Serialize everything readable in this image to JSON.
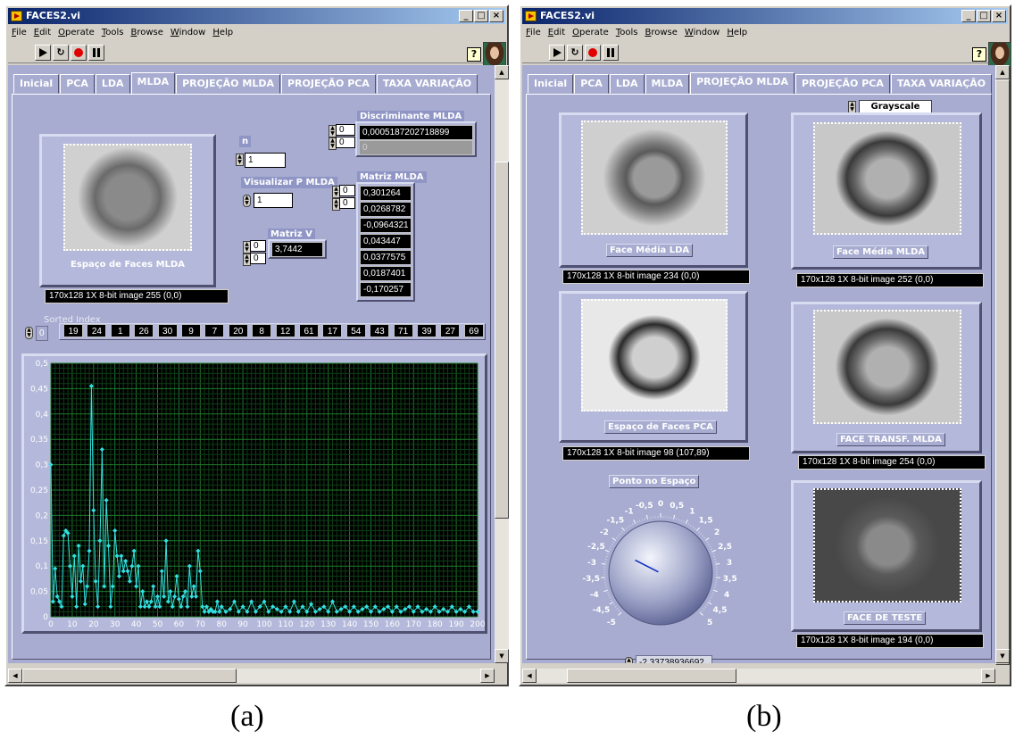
{
  "window_a": {
    "title": "FACES2.vi",
    "menu": [
      "File",
      "Edit",
      "Operate",
      "Tools",
      "Browse",
      "Window",
      "Help"
    ],
    "tabs": [
      "Inicial",
      "PCA",
      "LDA",
      "MLDA",
      "PROJEÇÃO MLDA",
      "PROJEÇÃO PCA",
      "TAXA VARIAÇÃO"
    ],
    "active_tab": "MLDA",
    "image_caption": "Espaço de Faces MLDA",
    "image_info": "170x128 1X 8-bit image 255    (0,0)",
    "n_label": "n",
    "n_value": "1",
    "visualizar_label": "Visualizar P MLDA",
    "visualizar_value": "1",
    "matriz_v_label": "Matriz V",
    "matriz_v_index_a": "0",
    "matriz_v_index_b": "0",
    "matriz_v_value": "3,7442",
    "discriminante_label": "Discriminante MLDA",
    "discriminante_index_a": "0",
    "discriminante_index_b": "0",
    "discriminante_value": "0,0005187202718899",
    "discriminante_value2": "0",
    "matriz_mlda_label": "Matriz MLDA",
    "matriz_mlda_index_a": "0",
    "matriz_mlda_index_b": "0",
    "matriz_mlda_values": [
      "0,301264",
      "0,0268782",
      "-0,0964321",
      "0,043447",
      "0,0377575",
      "0,0187401",
      "-0,170257"
    ],
    "sorted_index_label": "Sorted Index",
    "sorted_index_spin": "0",
    "sorted_index_values": [
      "19",
      "24",
      "1",
      "26",
      "30",
      "9",
      "7",
      "20",
      "8",
      "12",
      "61",
      "17",
      "54",
      "43",
      "71",
      "39",
      "27",
      "69"
    ]
  },
  "window_b": {
    "title": "FACES2.vi",
    "menu": [
      "File",
      "Edit",
      "Operate",
      "Tools",
      "Browse",
      "Window",
      "Help"
    ],
    "tabs": [
      "Inicial",
      "PCA",
      "LDA",
      "MLDA",
      "PROJEÇÃO MLDA",
      "PROJEÇÃO PCA",
      "TAXA VARIAÇÃO"
    ],
    "active_tab": "PROJEÇÃO MLDA",
    "colormap": "Grayscale",
    "face_media_lda": "Face Média LDA",
    "face_media_lda_info": "170x128 1X 8-bit image 234    (0,0)",
    "face_media_mlda": "Face Média MLDA",
    "face_media_mlda_info": "170x128 1X 8-bit image 252    (0,0)",
    "espaco_pca": "Espaço de Faces PCA",
    "espaco_pca_info": "170x128 1X 8-bit image 98   (107,89)",
    "face_transf": "FACE TRANSF. MLDA",
    "face_transf_info": "170x128 1X 8-bit image 254    (0,0)",
    "face_teste": "FACE DE TESTE",
    "face_teste_info": "170x128 1X 8-bit image 194    (0,0)",
    "knob_label": "Ponto no Espaço",
    "knob_ticks": [
      "-5",
      "-4,5",
      "-4",
      "-3,5",
      "-3",
      "-2,5",
      "-2",
      "-1,5",
      "-1",
      "-0,5",
      "0",
      "0,5",
      "1",
      "1,5",
      "2",
      "2,5",
      "3",
      "3,5",
      "4",
      "4,5",
      "5"
    ],
    "knob_value": 2.33738936692,
    "knob_readout": "-2,33738936692"
  },
  "chart_data": {
    "type": "line",
    "title": "",
    "xlabel": "",
    "ylabel": "",
    "xlim": [
      0,
      200
    ],
    "ylim": [
      0,
      0.5
    ],
    "xticks": [
      "0",
      "10",
      "20",
      "30",
      "40",
      "50",
      "60",
      "70",
      "80",
      "90",
      "100",
      "110",
      "120",
      "130",
      "140",
      "150",
      "160",
      "170",
      "180",
      "190",
      "200"
    ],
    "yticks": [
      "0",
      "0,05",
      "0,1",
      "0,15",
      "0,2",
      "0,25",
      "0,3",
      "0,35",
      "0,4",
      "0,45",
      "0,5"
    ],
    "grid": true,
    "series": [
      {
        "color": "#33e0e0",
        "x": [
          0,
          1,
          2,
          3,
          4,
          5,
          6,
          7,
          8,
          9,
          10,
          11,
          12,
          13,
          14,
          15,
          16,
          17,
          18,
          19,
          20,
          21,
          22,
          23,
          24,
          25,
          26,
          27,
          28,
          29,
          30,
          31,
          32,
          33,
          34,
          35,
          36,
          37,
          38,
          39,
          40,
          41,
          42,
          43,
          44,
          45,
          46,
          47,
          48,
          49,
          50,
          51,
          52,
          53,
          54,
          55,
          56,
          57,
          58,
          59,
          60,
          61,
          62,
          63,
          64,
          65,
          66,
          67,
          68,
          69,
          70,
          71,
          72,
          73,
          74,
          75,
          76,
          77,
          78,
          79,
          80,
          82,
          84,
          86,
          88,
          90,
          92,
          94,
          96,
          98,
          100,
          102,
          104,
          106,
          108,
          110,
          112,
          114,
          116,
          118,
          120,
          122,
          124,
          126,
          128,
          130,
          132,
          134,
          136,
          138,
          140,
          142,
          144,
          146,
          148,
          150,
          152,
          154,
          156,
          158,
          160,
          162,
          164,
          166,
          168,
          170,
          172,
          174,
          176,
          178,
          180,
          182,
          184,
          186,
          188,
          190,
          192,
          194,
          196,
          198,
          200
        ],
        "y": [
          0.3,
          0.03,
          0.095,
          0.04,
          0.03,
          0.02,
          0.16,
          0.17,
          0.165,
          0.1,
          0.04,
          0.12,
          0.02,
          0.14,
          0.07,
          0.1,
          0.025,
          0.06,
          0.13,
          0.455,
          0.21,
          0.07,
          0.02,
          0.15,
          0.33,
          0.06,
          0.23,
          0.14,
          0.02,
          0.06,
          0.17,
          0.12,
          0.08,
          0.12,
          0.09,
          0.11,
          0.09,
          0.07,
          0.1,
          0.13,
          0.06,
          0.1,
          0.02,
          0.05,
          0.02,
          0.03,
          0.02,
          0.03,
          0.06,
          0.02,
          0.04,
          0.02,
          0.09,
          0.04,
          0.15,
          0.03,
          0.05,
          0.02,
          0.04,
          0.08,
          0.035,
          0.02,
          0.04,
          0.05,
          0.02,
          0.1,
          0.04,
          0.06,
          0.04,
          0.13,
          0.09,
          0.02,
          0.01,
          0.02,
          0.01,
          0.015,
          0.01,
          0.01,
          0.03,
          0.01,
          0.02,
          0.01,
          0.015,
          0.03,
          0.01,
          0.02,
          0.01,
          0.03,
          0.01,
          0.02,
          0.03,
          0.01,
          0.02,
          0.015,
          0.01,
          0.02,
          0.01,
          0.03,
          0.01,
          0.02,
          0.01,
          0.025,
          0.01,
          0.015,
          0.02,
          0.01,
          0.03,
          0.01,
          0.015,
          0.02,
          0.01,
          0.02,
          0.01,
          0.015,
          0.02,
          0.01,
          0.02,
          0.01,
          0.015,
          0.02,
          0.01,
          0.02,
          0.01,
          0.015,
          0.02,
          0.01,
          0.02,
          0.01,
          0.015,
          0.01,
          0.02,
          0.01,
          0.015,
          0.01,
          0.02,
          0.01,
          0.015,
          0.01,
          0.02,
          0.01,
          0.01
        ]
      }
    ]
  },
  "figure_labels": {
    "a": "(a)",
    "b": "(b)"
  }
}
